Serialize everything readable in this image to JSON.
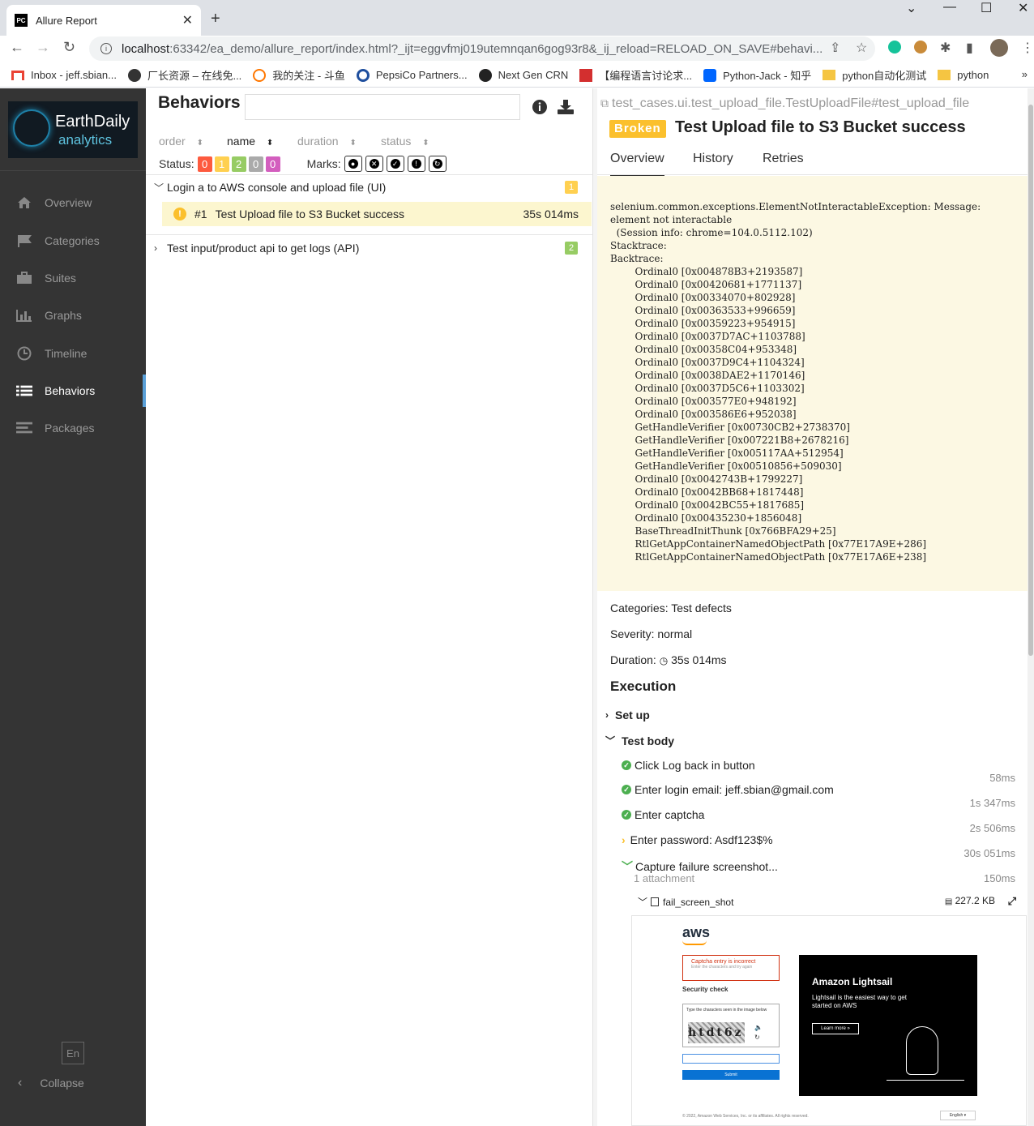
{
  "browser": {
    "tab_title": "Allure Report",
    "tab_favicon_text": "PC",
    "url_host": "localhost",
    "url_rest": ":63342/ea_demo/allure_report/index.html?_ijt=eggvfmj019utemnqan6gog93r8&_ij_reload=RELOAD_ON_SAVE#behavi...",
    "bookmarks": [
      {
        "label": "Inbox - jeff.sbian...",
        "icon": "gmail-icon",
        "color": "#ea4335"
      },
      {
        "label": "厂长资源 – 在线免...",
        "icon": "site-icon",
        "color": "#333333"
      },
      {
        "label": "我的关注 - 斗鱼",
        "icon": "douyu-icon",
        "color": "#ff7700"
      },
      {
        "label": "PepsiCo Partners...",
        "icon": "pepsico-icon",
        "color": "#1f4f9e"
      },
      {
        "label": "Next Gen CRN",
        "icon": "paw-icon",
        "color": "#222222"
      },
      {
        "label": "【编程语言讨论求...",
        "icon": "site-icon",
        "color": "#d32f2f"
      },
      {
        "label": "Python-Jack - 知乎",
        "icon": "zhihu-icon",
        "color": "#0066ff"
      },
      {
        "label": "python自动化测试",
        "icon": "folder-icon",
        "color": "#f5c542"
      },
      {
        "label": "python",
        "icon": "folder-icon",
        "color": "#f5c542"
      }
    ]
  },
  "sidebar": {
    "logo_line1": "EarthDaily",
    "logo_line2": "analytics",
    "items": [
      {
        "label": "Overview",
        "icon": "home-icon"
      },
      {
        "label": "Categories",
        "icon": "flag-icon"
      },
      {
        "label": "Suites",
        "icon": "briefcase-icon"
      },
      {
        "label": "Graphs",
        "icon": "bar-chart-icon"
      },
      {
        "label": "Timeline",
        "icon": "clock-icon"
      },
      {
        "label": "Behaviors",
        "icon": "list-icon",
        "active": true
      },
      {
        "label": "Packages",
        "icon": "align-left-icon"
      }
    ],
    "lang": "En",
    "collapse": "Collapse"
  },
  "behaviors": {
    "title": "Behaviors",
    "sort": [
      "order",
      "name",
      "duration",
      "status"
    ],
    "status_label": "Status:",
    "status_counts": [
      {
        "value": "0",
        "color": "#fd5a3e"
      },
      {
        "value": "1",
        "color": "#ffd050"
      },
      {
        "value": "2",
        "color": "#97cc64"
      },
      {
        "value": "0",
        "color": "#aaaaaa"
      },
      {
        "value": "0",
        "color": "#d35ebe"
      }
    ],
    "marks_label": "Marks:",
    "groups": [
      {
        "name": "Login a to AWS console and upload file (UI)",
        "count": "1",
        "color": "#ffd050",
        "expanded": true
      },
      {
        "name": "Test input/product api to get logs (API)",
        "count": "2",
        "color": "#97cc64",
        "expanded": false
      }
    ],
    "test": {
      "num": "#1",
      "name": "Test Upload file to S3 Bucket success",
      "duration": "35s 014ms"
    }
  },
  "details": {
    "fullname": "test_cases.ui.test_upload_file.TestUploadFile#test_upload_file",
    "status": "Broken",
    "status_color": "#fbc02d",
    "title": "Test Upload file to S3 Bucket success",
    "tabs": [
      "Overview",
      "History",
      "Retries"
    ],
    "trace": "selenium.common.exceptions.ElementNotInteractableException: Message:\nelement not interactable\n  (Session info: chrome=104.0.5112.102)\nStacktrace:\nBacktrace:\n\tOrdinal0 [0x004878B3+2193587]\n\tOrdinal0 [0x00420681+1771137]\n\tOrdinal0 [0x00334070+802928]\n\tOrdinal0 [0x00363533+996659]\n\tOrdinal0 [0x00359223+954915]\n\tOrdinal0 [0x0037D7AC+1103788]\n\tOrdinal0 [0x00358C04+953348]\n\tOrdinal0 [0x0037D9C4+1104324]\n\tOrdinal0 [0x0038DAE2+1170146]\n\tOrdinal0 [0x0037D5C6+1103302]\n\tOrdinal0 [0x003577E0+948192]\n\tOrdinal0 [0x003586E6+952038]\n\tGetHandleVerifier [0x00730CB2+2738370]\n\tGetHandleVerifier [0x007221B8+2678216]\n\tGetHandleVerifier [0x005117AA+512954]\n\tGetHandleVerifier [0x00510856+509030]\n\tOrdinal0 [0x0042743B+1799227]\n\tOrdinal0 [0x0042BB68+1817448]\n\tOrdinal0 [0x0042BC55+1817685]\n\tOrdinal0 [0x00435230+1856048]\n\tBaseThreadInitThunk [0x766BFA29+25]\n\tRtlGetAppContainerNamedObjectPath [0x77E17A9E+286]\n\tRtlGetAppContainerNamedObjectPath [0x77E17A6E+238]",
    "categories": "Categories: Test defects",
    "severity": "Severity: normal",
    "duration_label": "Duration:",
    "duration": "35s 014ms",
    "execution": "Execution",
    "setup": "Set up",
    "test_body": "Test body",
    "steps": [
      {
        "name": "Click Log back in button",
        "duration": "58ms",
        "status": "passed"
      },
      {
        "name": "Enter login email: jeff.sbian@gmail.com",
        "duration": "1s 347ms",
        "status": "passed"
      },
      {
        "name": "Enter captcha",
        "duration": "2s 506ms",
        "status": "passed"
      },
      {
        "name": "Enter password: Asdf123$%",
        "duration": "30s 051ms",
        "status": "collapsed"
      },
      {
        "name": "Capture failure screenshot...",
        "duration": "150ms",
        "status": "expanded"
      }
    ],
    "attachment_count": "1 attachment",
    "attachment_name": "fail_screen_shot",
    "attachment_size": "227.2 KB"
  },
  "screenshot": {
    "logo": "aws",
    "error_title": "Captcha entry is incorrect",
    "error_sub": "Enter the characters and try again",
    "security_check": "Security check",
    "captcha_prompt": "Type the characters seen in the image below",
    "captcha_text": "htdt6z",
    "submit": "Submit",
    "promo_title": "Amazon Lightsail",
    "promo_text": "Lightsail is the easiest way to get started on AWS",
    "promo_button": "Learn more »",
    "footer": "© 2022, Amazon Web Services, Inc. or its affiliates. All rights reserved.",
    "lang": "English ▾"
  }
}
